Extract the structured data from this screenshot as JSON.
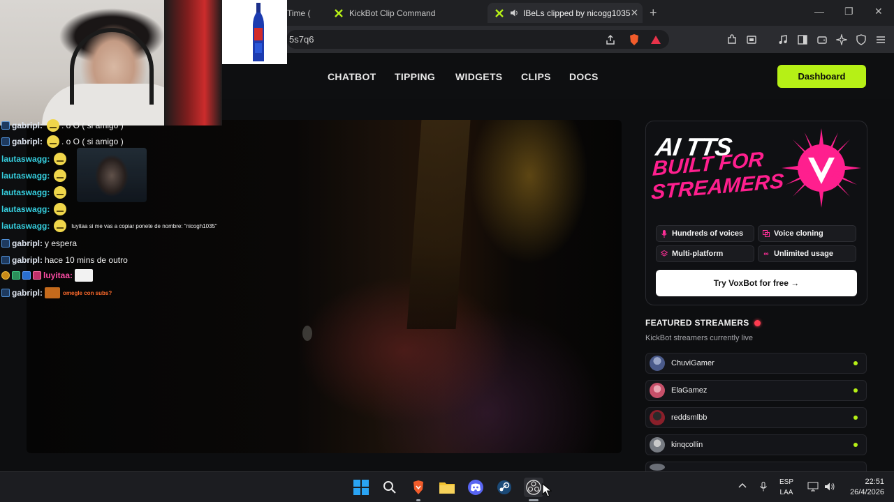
{
  "browser": {
    "tabs": [
      {
        "label": "Time (",
        "active": false
      },
      {
        "label": "KickBot Clip Command",
        "active": false
      },
      {
        "label": "IBeLs clipped by nicogg1035",
        "active": true
      }
    ],
    "url_fragment": "5s7q6"
  },
  "site_nav": {
    "links": [
      "CHATBOT",
      "TIPPING",
      "WIDGETS",
      "CLIPS",
      "DOCS"
    ],
    "dashboard_label": "Dashboard",
    "accent_color": "#b6f016"
  },
  "chat": {
    "lines": [
      {
        "user": "gabripl:",
        "user_color": "#dfe6f1",
        "msg": ". o O ( si amigo )"
      },
      {
        "user": "gabripl:",
        "user_color": "#dfe6f1",
        "msg": ". o O ( si amigo )"
      },
      {
        "user": "lautaswagg:",
        "user_color": "#36d0e0",
        "msg": ""
      },
      {
        "user": "lautaswagg:",
        "user_color": "#36d0e0",
        "msg": ""
      },
      {
        "user": "lautaswagg:",
        "user_color": "#36d0e0",
        "msg": ""
      },
      {
        "user": "lautaswagg:",
        "user_color": "#36d0e0",
        "msg": ""
      },
      {
        "user": "lautaswagg:",
        "user_color": "#36d0e0",
        "msg": "luyitaa si me vas a copiar ponete de nombre: \"nicogh1035\""
      },
      {
        "user": "gabripl:",
        "user_color": "#dfe6f1",
        "msg": "y espera"
      },
      {
        "user": "gabripl:",
        "user_color": "#dfe6f1",
        "msg": "hace 10 mins de outro"
      },
      {
        "user": "luyitaa:",
        "user_color": "#ff4da6",
        "msg": ""
      },
      {
        "user": "gabripl:",
        "user_color": "#dfe6f1",
        "msg": "omegle con subs?"
      }
    ]
  },
  "promo": {
    "title_line1": "AI TTS",
    "title_line2": "BUILT FOR\nSTREAMERS",
    "features": [
      {
        "label": "Hundreds of voices",
        "icon": "mic-icon"
      },
      {
        "label": "Voice cloning",
        "icon": "copy-icon"
      },
      {
        "label": "Multi-platform",
        "icon": "layers-icon"
      },
      {
        "label": "Unlimited usage",
        "icon": "infinity-icon"
      }
    ],
    "cta_label": "Try VoxBot for free →",
    "brand_color": "#ff1f8e"
  },
  "featured": {
    "title": "FEATURED STREAMERS",
    "subtitle": "KickBot streamers currently live",
    "streamers": [
      {
        "name": "ChuviGamer",
        "avatar_color": "#4a5a8a"
      },
      {
        "name": "ElaGamez",
        "avatar_color": "#c7506a"
      },
      {
        "name": "reddsmlbb",
        "avatar_color": "#8a1f2a"
      },
      {
        "name": "kinqcollin",
        "avatar_color": "#777b82"
      }
    ]
  },
  "taskbar": {
    "apps": [
      "windows-start-icon",
      "search-icon",
      "brave-icon",
      "file-explorer-icon",
      "discord-icon",
      "steam-icon",
      "obs-icon"
    ],
    "lang_line1": "ESP",
    "lang_line2": "LAA",
    "time": "22:51",
    "date": "26/4/2026"
  }
}
